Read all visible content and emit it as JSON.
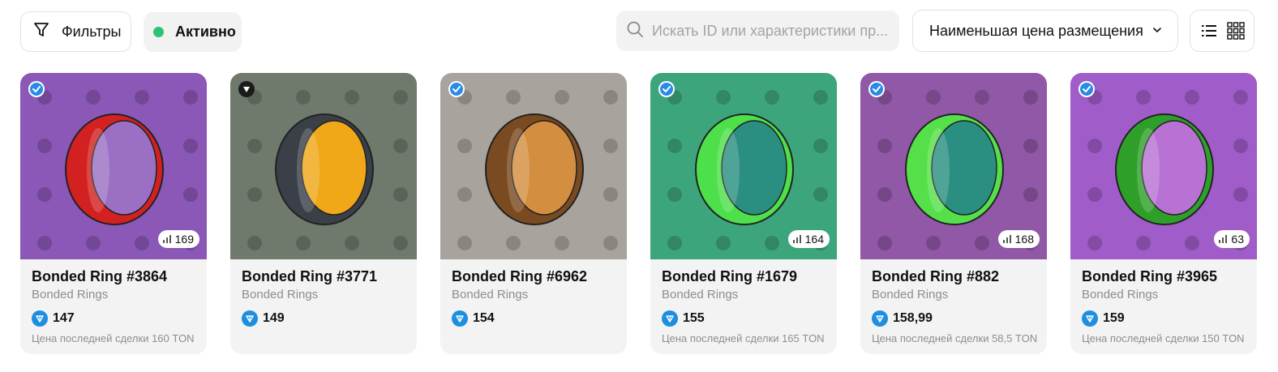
{
  "toolbar": {
    "filters_label": "Фильтры",
    "active_label": "Активно",
    "search_placeholder": "Искать ID или характеристики пр...",
    "sort_label": "Наименьшая цена размещения",
    "colors": {
      "active_dot": "#2fc276",
      "ton": "#1e8fe0"
    }
  },
  "cards": [
    {
      "title": "Bonded Ring #3864",
      "collection": "Bonded Rings",
      "price": "147",
      "rank": "169",
      "last_sale": "Цена последней сделки 160 TON",
      "bg": "#8b58b8",
      "ring": "#d32020",
      "inner": "#9b6fc4",
      "badge": "blue-check-icon"
    },
    {
      "title": "Bonded Ring #3771",
      "collection": "Bonded Rings",
      "price": "149",
      "rank": "",
      "last_sale": "",
      "bg": "#6f7a6c",
      "ring": "#3a3f48",
      "inner": "#f0a818",
      "badge": "dark-arrow-icon"
    },
    {
      "title": "Bonded Ring #6962",
      "collection": "Bonded Rings",
      "price": "154",
      "rank": "",
      "last_sale": "",
      "bg": "#a8a49d",
      "ring": "#7a4a20",
      "inner": "#d48e40",
      "badge": "blue-check-icon"
    },
    {
      "title": "Bonded Ring #1679",
      "collection": "Bonded Rings",
      "price": "155",
      "rank": "164",
      "last_sale": "Цена последней сделки 165 TON",
      "bg": "#3da57c",
      "ring": "#4ee04a",
      "inner": "#2a8f80",
      "badge": "blue-check-icon"
    },
    {
      "title": "Bonded Ring #882",
      "collection": "Bonded Rings",
      "price": "158,99",
      "rank": "168",
      "last_sale": "Цена последней сделки 58,5 TON",
      "bg": "#9058a6",
      "ring": "#55e04a",
      "inner": "#2a8f80",
      "badge": "blue-check-icon"
    },
    {
      "title": "Bonded Ring #3965",
      "collection": "Bonded Rings",
      "price": "159",
      "rank": "63",
      "last_sale": "Цена последней сделки 150 TON",
      "bg": "#a05cc8",
      "ring": "#2ea02a",
      "inner": "#b872d4",
      "badge": "blue-check-icon"
    }
  ]
}
